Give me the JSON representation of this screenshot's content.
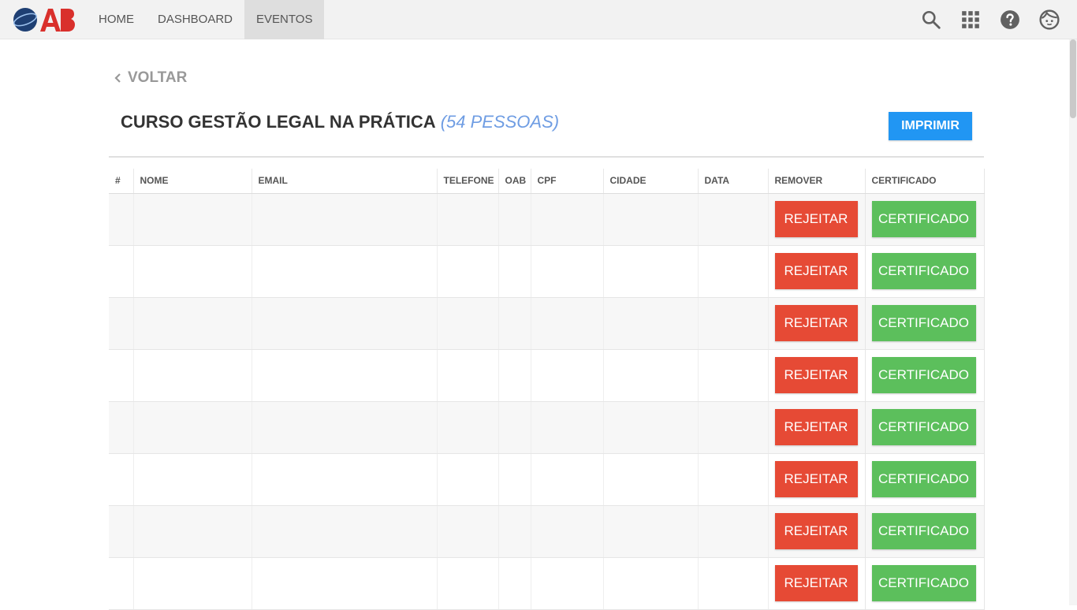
{
  "colors": {
    "nav_bg": "#f2f2f2",
    "accent_blue": "#2196f3",
    "reject_red": "#e64a35",
    "certificate_green": "#5cbf5c",
    "count_blue": "#6f9de3",
    "logo_red": "#d9302c",
    "logo_blue": "#1e3f73"
  },
  "header": {
    "logo_text": "OAB",
    "nav": [
      {
        "label": "HOME"
      },
      {
        "label": "DASHBOARD"
      },
      {
        "label": "EVENTOS"
      }
    ],
    "icons": [
      "search-icon",
      "apps-grid-icon",
      "help-icon",
      "account-icon"
    ]
  },
  "page": {
    "back_label": "VOLTAR",
    "title": "CURSO GESTÃO LEGAL NA PRÁTICA",
    "count": "(54 PESSOAS)",
    "print_label": "IMPRIMIR"
  },
  "table": {
    "columns": [
      "#",
      "NOME",
      "EMAIL",
      "TELEFONE",
      "OAB",
      "CPF",
      "CIDADE",
      "DATA",
      "REMOVER",
      "CERTIFICADO"
    ],
    "reject_label": "REJEITAR",
    "certificate_label": "CERTIFICADO",
    "rows": [
      {
        "num": "",
        "name": "",
        "email": "",
        "phone": "",
        "oab": "",
        "cpf": "",
        "city": "",
        "date": ""
      },
      {
        "num": "",
        "name": "",
        "email": "",
        "phone": "",
        "oab": "",
        "cpf": "",
        "city": "",
        "date": ""
      },
      {
        "num": "",
        "name": "",
        "email": "",
        "phone": "",
        "oab": "",
        "cpf": "",
        "city": "",
        "date": ""
      },
      {
        "num": "",
        "name": "",
        "email": "",
        "phone": "",
        "oab": "",
        "cpf": "",
        "city": "",
        "date": ""
      },
      {
        "num": "",
        "name": "",
        "email": "",
        "phone": "",
        "oab": "",
        "cpf": "",
        "city": "",
        "date": ""
      },
      {
        "num": "",
        "name": "",
        "email": "",
        "phone": "",
        "oab": "",
        "cpf": "",
        "city": "",
        "date": ""
      },
      {
        "num": "",
        "name": "",
        "email": "",
        "phone": "",
        "oab": "",
        "cpf": "",
        "city": "",
        "date": ""
      },
      {
        "num": "",
        "name": "",
        "email": "",
        "phone": "",
        "oab": "",
        "cpf": "",
        "city": "",
        "date": ""
      }
    ]
  }
}
